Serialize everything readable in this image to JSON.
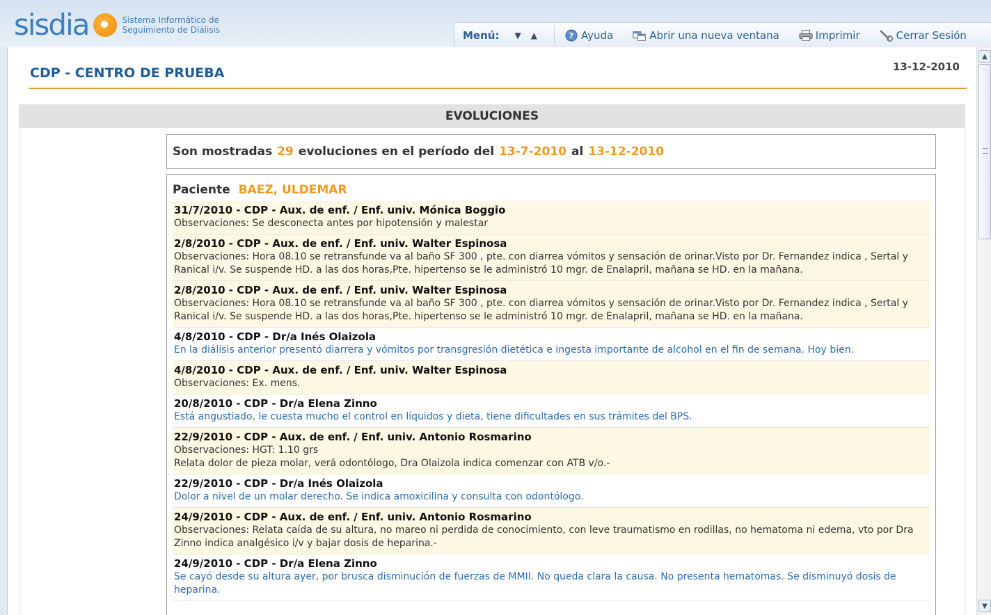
{
  "header": {
    "logo_text": "sisdia",
    "logo_sub_1": "Sistema Informático de",
    "logo_sub_2": "Seguimiento de Diálisis",
    "menu_label": "Menú:",
    "help": "Ayuda",
    "new_window": "Abrir una nueva ventana",
    "print": "Imprimir",
    "logout": "Cerrar Sesión"
  },
  "page": {
    "center_title": "CDP - CENTRO DE PRUEBA",
    "date": "13-12-2010",
    "section_title": "EVOLUCIONES"
  },
  "summary": {
    "pre": "Son mostradas",
    "count": "29",
    "mid": "evoluciones en el período del",
    "from": "13-7-2010",
    "al": "al",
    "to": "13-12-2010"
  },
  "patient": {
    "label": "Paciente",
    "name": "BAEZ, ULDEMAR"
  },
  "entries": [
    {
      "head": "31/7/2010 - CDP - Aux. de enf. / Enf. univ. Mónica Boggio",
      "text": "Observaciones: Se desconecta antes por hipotensión y malestar",
      "text2": ""
    },
    {
      "head": "2/8/2010 - CDP - Aux. de enf. / Enf. univ. Walter Espinosa",
      "text": "Observaciones: Hora 08.10 se retransfunde va al baño SF 300 , pte. con diarrea vómitos y sensación de orinar.Visto por Dr. Fernandez indica , Sertal y Ranical i/v. Se suspende HD. a las dos horas,Pte. hipertenso se le administró 10 mgr. de Enalapril, mañana se HD. en la mañana.",
      "text2": ""
    },
    {
      "head": "2/8/2010 - CDP - Aux. de enf. / Enf. univ. Walter Espinosa",
      "text": "Observaciones: Hora 08.10 se retransfunde va al baño SF 300 , pte. con diarrea vómitos y sensación de orinar.Visto por Dr. Fernandez indica , Sertal y Ranical i/v. Se suspende HD. a las dos horas,Pte. hipertenso se le administró 10 mgr. de Enalapril, mañana se HD. en la mañana.",
      "text2": ""
    },
    {
      "head": "4/8/2010 - CDP - Dr/a Inés Olaizola",
      "text": "En la diálisis anterior presentó diarrera y vómitos por transgresión dietética e ingesta importante de alcohol en el fin de semana. Hoy bien.",
      "text2": ""
    },
    {
      "head": "4/8/2010 - CDP - Aux. de enf. / Enf. univ. Walter Espinosa",
      "text": "Observaciones: Ex. mens.",
      "text2": ""
    },
    {
      "head": "20/8/2010 - CDP - Dr/a Elena Zinno",
      "text": "Está angustiado, le cuesta mucho el control en líquidos y dieta, tiene dificultades en sus trámites del BPS.",
      "text2": ""
    },
    {
      "head": "22/9/2010 - CDP - Aux. de enf. / Enf. univ. Antonio Rosmarino",
      "text": "Observaciones: HGT: 1.10 grs",
      "text2": "Relata dolor de pieza molar, verá odontólogo, Dra Olaizola indica comenzar con ATB v/o.-"
    },
    {
      "head": "22/9/2010 - CDP - Dr/a Inés Olaizola",
      "text": "Dolor a nivel de un molar derecho. Se indica amoxicilina y consulta con odontólogo.",
      "text2": ""
    },
    {
      "head": "24/9/2010 - CDP - Aux. de enf. / Enf. univ. Antonio Rosmarino",
      "text": "Observaciones: Relata caída de su altura, no mareo ni perdida de conocimiento, con leve traumatismo en rodillas, no hematoma ni edema, vto por Dra Zinno indica analgésico i/v y bajar dosis de heparina.-",
      "text2": ""
    },
    {
      "head": "24/9/2010 - CDP - Dr/a Elena Zinno",
      "text": "Se cayó desde su altura ayer, por brusca disminución de fuerzas de MMII. No queda clara la causa. No presenta hematomas. Se disminuyó dosis de heparina.",
      "text2": ""
    }
  ],
  "colors": {
    "accent_orange": "#ef9a1c",
    "title_blue": "#1f5c99",
    "doctor_text_blue": "#2a6db0",
    "aux_row_bg": "#fdf8e3"
  },
  "icons": [
    "chevron-down-icon",
    "chevron-up-icon",
    "help-icon",
    "new-window-icon",
    "printer-icon",
    "logout-icon"
  ]
}
